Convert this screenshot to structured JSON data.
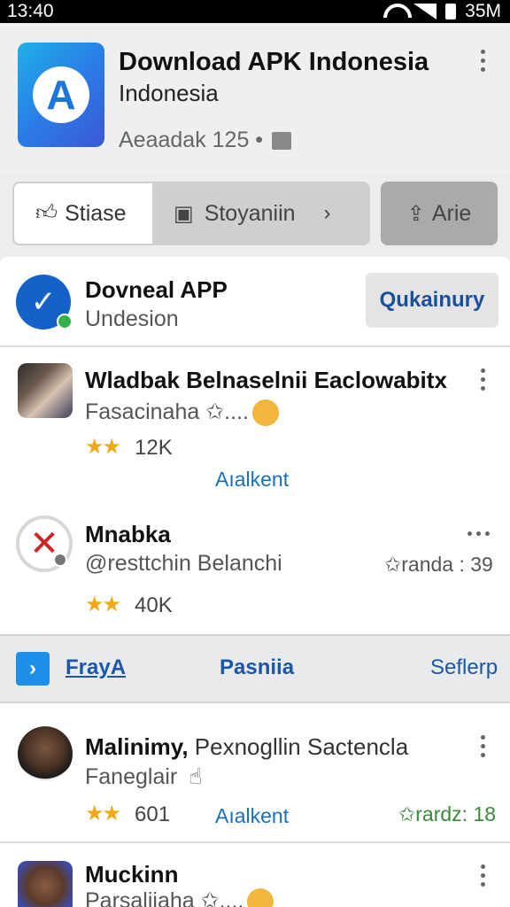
{
  "status_bar": {
    "time": "13:40",
    "right_text": "35M"
  },
  "header": {
    "title": "Download APK Indonesia",
    "subtitle": "Indonesia",
    "meta": "Aeaadak 125 •"
  },
  "tabs": {
    "share_label": "Stiase",
    "store_label": "Stoyaniin",
    "arie_label": "Arie"
  },
  "promo": {
    "title": "Dovneal APP",
    "subtitle": "Undesion",
    "button_label": "Qukainury"
  },
  "items": [
    {
      "title": "Wladbak Belnaselnii Eaclowabitx",
      "subtitle": "Fasacinaha",
      "subtitle_suffix": "✩....",
      "stars": "★★",
      "count": "12K",
      "link": "Aıalkent"
    },
    {
      "title": "Mnabka",
      "subtitle": "@resttchin Belanchi",
      "rating": "✩randa : 39",
      "stars": "★★",
      "count": "40K"
    },
    {
      "title": "Malinimy,",
      "title_suffix": "Pexnogllin Sactencla",
      "subtitle": "Faneglair",
      "stars": "★★",
      "count": "601",
      "link": "Aıalkent",
      "rating": "✩rardz: 18"
    },
    {
      "title": "Muckinn",
      "subtitle": "Parsaliiaha",
      "subtitle_suffix": "✩...."
    }
  ],
  "nav": {
    "item1": "FrayA",
    "item2": "Pasniia",
    "item3": "Seflerp"
  },
  "colors": {
    "accent": "#1b56a8",
    "star": "#f0a915",
    "link": "#1b6fb8"
  }
}
